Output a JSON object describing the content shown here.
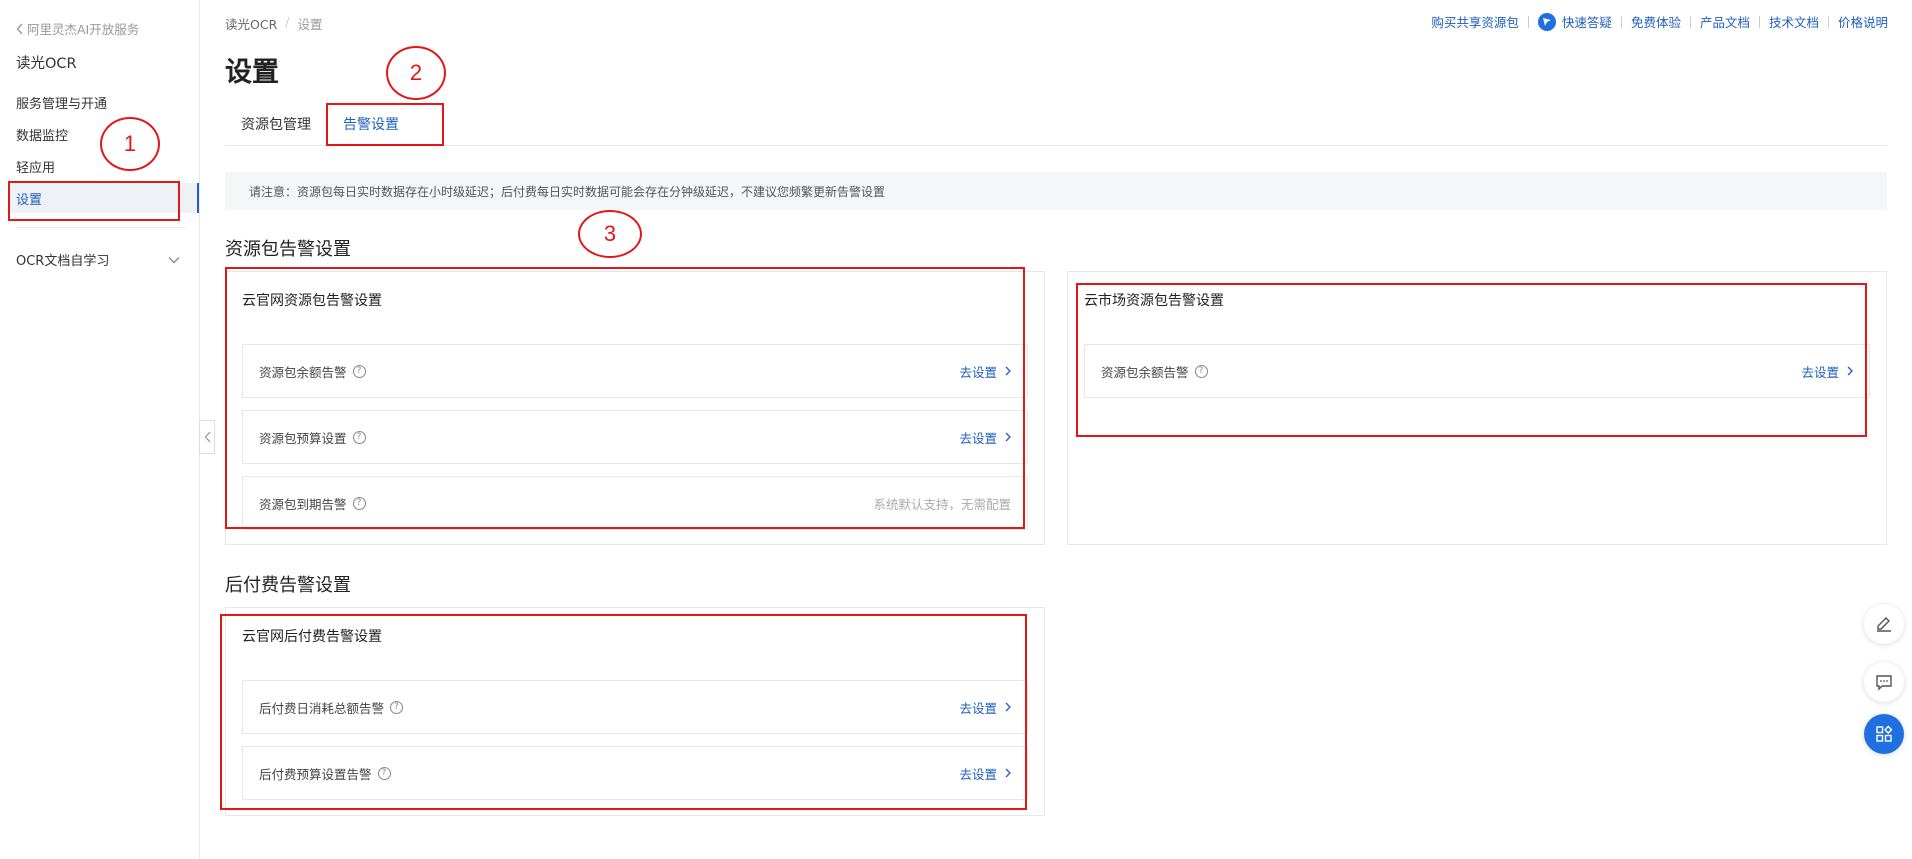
{
  "sidebar": {
    "back_label": "阿里灵杰AI开放服务",
    "title": "读光OCR",
    "items": [
      {
        "label": "服务管理与开通"
      },
      {
        "label": "数据监控"
      },
      {
        "label": "轻应用"
      },
      {
        "label": "设置"
      }
    ],
    "group_label": "OCR文档自学习"
  },
  "breadcrumb": {
    "root": "读光OCR",
    "separator": "/",
    "current": "设置"
  },
  "toplinks": {
    "buy": "购买共享资源包",
    "qa": "快速答疑",
    "trial": "免费体验",
    "product_docs": "产品文档",
    "tech_docs": "技术文档",
    "pricing": "价格说明"
  },
  "page": {
    "title": "设置"
  },
  "tabs": {
    "package": "资源包管理",
    "alert": "告警设置"
  },
  "notice": "请注意：资源包每日实时数据存在小时级延迟；后付费每日实时数据可能会存在分钟级延迟，不建议您频繁更新告警设置",
  "section_package": {
    "title": "资源包告警设置",
    "official": {
      "title": "云官网资源包告警设置",
      "rows": [
        {
          "label": "资源包余额告警",
          "action": "去设置"
        },
        {
          "label": "资源包预算设置",
          "action": "去设置"
        },
        {
          "label": "资源包到期告警",
          "status": "系统默认支持，无需配置"
        }
      ]
    },
    "market": {
      "title": "云市场资源包告警设置",
      "rows": [
        {
          "label": "资源包余额告警",
          "action": "去设置"
        }
      ]
    }
  },
  "section_postpay": {
    "title": "后付费告警设置",
    "official": {
      "title": "云官网后付费告警设置",
      "rows": [
        {
          "label": "后付费日消耗总额告警",
          "action": "去设置"
        },
        {
          "label": "后付费预算设置告警",
          "action": "去设置"
        }
      ]
    }
  },
  "annotations": {
    "one": "1",
    "two": "2",
    "three": "3"
  },
  "colors": {
    "accent": "#1f5fbf",
    "annotation": "#e3171a"
  },
  "icons": {
    "back": "chevron-left-icon",
    "group": "chevron-down-icon",
    "help": "question-circle-icon",
    "go": "chevron-right-icon",
    "qa": "qa-bubble-icon",
    "edit": "edit-icon",
    "chat": "chat-icon",
    "apps": "apps-icon"
  }
}
